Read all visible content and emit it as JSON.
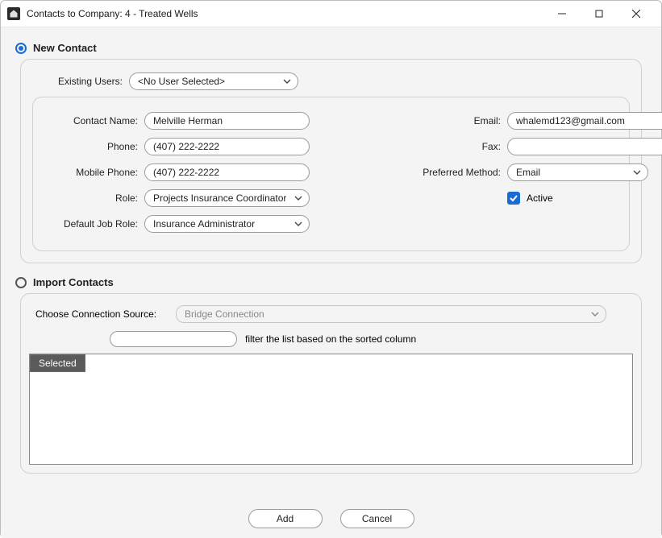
{
  "window": {
    "title": "Contacts to Company: 4 - Treated Wells"
  },
  "newContact": {
    "heading": "New Contact",
    "existingUsersLabel": "Existing Users:",
    "existingUsersValue": "<No User Selected>",
    "fields": {
      "contactNameLabel": "Contact Name:",
      "contactNameValue": "Melville Herman",
      "phoneLabel": "Phone:",
      "phoneValue": "(407) 222-2222",
      "mobileLabel": "Mobile Phone:",
      "mobileValue": "(407) 222-2222",
      "roleLabel": "Role:",
      "roleValue": "Projects Insurance Coordinator",
      "defaultJobRoleLabel": "Default Job Role:",
      "defaultJobRoleValue": "Insurance Administrator",
      "emailLabel": "Email:",
      "emailValue": "whalemd123@gmail.com",
      "faxLabel": "Fax:",
      "faxValue": "",
      "preferredMethodLabel": "Preferred Method:",
      "preferredMethodValue": "Email",
      "activeLabel": "Active"
    }
  },
  "importContacts": {
    "heading": "Import Contacts",
    "sourceLabel": "Choose Connection Source:",
    "sourceValue": "Bridge Connection",
    "filterHint": "filter the list based on the sorted column",
    "gridHeader": "Selected"
  },
  "buttons": {
    "add": "Add",
    "cancel": "Cancel"
  }
}
